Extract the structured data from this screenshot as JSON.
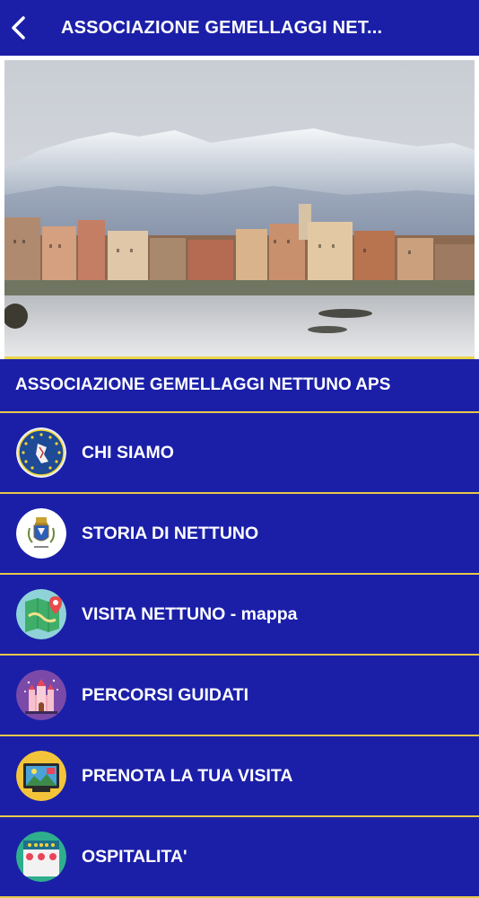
{
  "header": {
    "title": "ASSOCIAZIONE GEMELLAGGI NET...",
    "back_icon": "chevron-left-icon"
  },
  "hero": {
    "image_description_icon": "coastal-town-mountains-photo"
  },
  "section": {
    "title": "ASSOCIAZIONE GEMELLAGGI NETTUNO APS"
  },
  "menu": {
    "items": [
      {
        "label": "CHI SIAMO",
        "icon": "association-emblem-icon"
      },
      {
        "label": "STORIA DI NETTUNO",
        "icon": "town-crest-icon"
      },
      {
        "label": "VISITA NETTUNO - mappa",
        "icon": "map-pin-icon"
      },
      {
        "label": "PERCORSI GUIDATI",
        "icon": "castle-icon"
      },
      {
        "label": "PRENOTA LA TUA VISITA",
        "icon": "picture-frame-icon"
      },
      {
        "label": "OSPITALITA'",
        "icon": "hotel-icon"
      }
    ]
  },
  "colors": {
    "primary": "#1b1fa8",
    "divider": "#e7c84a"
  }
}
